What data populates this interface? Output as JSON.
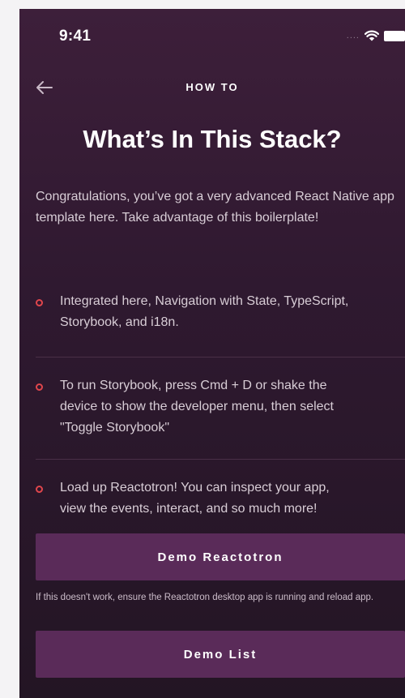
{
  "status_bar": {
    "time": "9:41",
    "signal_text": "....",
    "icons": [
      "signal-dots-icon",
      "wifi-icon",
      "battery-icon"
    ]
  },
  "nav": {
    "back_icon": "arrow-left-icon",
    "title": "HOW TO"
  },
  "main": {
    "title": "What’s In This Stack?",
    "intro": "Congratulations, you’ve got a very advanced React Native app template here.  Take advantage of this boilerplate!",
    "bullets": [
      {
        "line1": "Integrated here, Navigation with State, TypeScript,",
        "line2": "Storybook, and i18n."
      },
      {
        "line1": "To run Storybook, press Cmd + D or shake the",
        "line2": "device to show the developer menu, then select",
        "line3": "\"Toggle Storybook\""
      },
      {
        "line1": "Load up Reactotron! You can inspect your app,",
        "line2": "view the events, interact, and so much more!"
      }
    ],
    "demo_reactotron_label": "Demo Reactotron",
    "hint": "If this doesn't work, ensure the Reactotron desktop app is running and reload app.",
    "demo_list_label": "Demo List"
  },
  "colors": {
    "background_top": "#3d1f3a",
    "background_bottom": "#231524",
    "button": "#5a2b59",
    "bullet_accent": "#e0464c",
    "body_text": "#d8cdd6"
  }
}
